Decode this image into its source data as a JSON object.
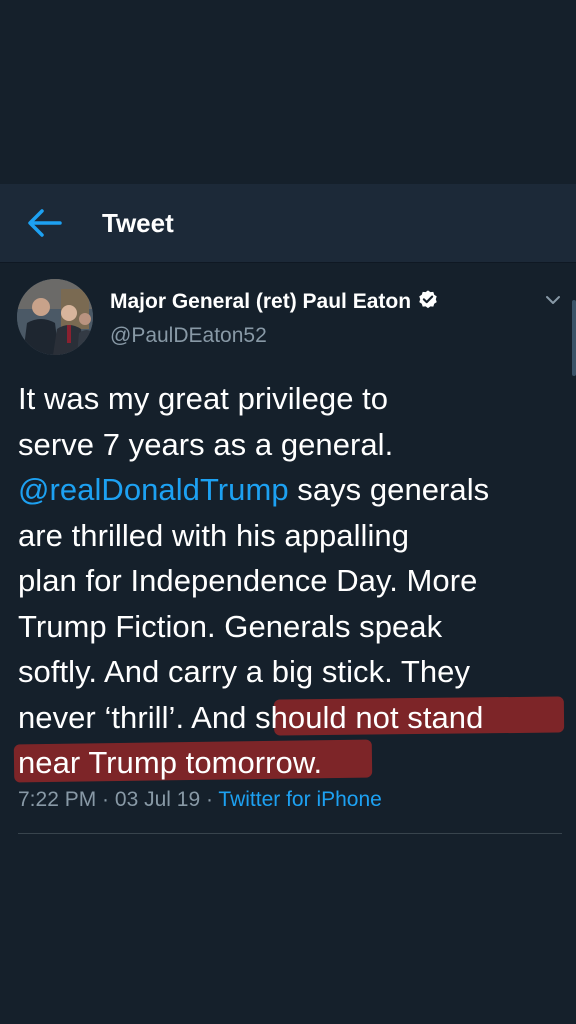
{
  "header": {
    "title": "Tweet"
  },
  "tweet": {
    "author_name": "Major General (ret) Paul Eaton",
    "author_handle": "@PaulDEaton52",
    "lines": {
      "l1": "It was my great privilege to",
      "l2": "serve 7 years as a general.",
      "mention": "@realDonaldTrump",
      "l3_rest": " says generals",
      "l4": "are thrilled with his appalling",
      "l5": "plan for Independence Day. More",
      "l6": "Trump Fiction. Generals speak",
      "l7": "softly. And carry a big stick. They",
      "l8_pre": "never ‘thrill’. And ",
      "l8_highlight": "should not stand",
      "l9_highlight": "near Trump tomorrow."
    },
    "time": "7:22 PM",
    "date": "03 Jul 19",
    "separator": " · ",
    "source": "Twitter for iPhone"
  },
  "colors": {
    "background": "#15202b",
    "header": "#1c2938",
    "accent": "#1da1f2",
    "secondary_text": "#8899a6",
    "highlight": "#aa2828"
  },
  "icons": {
    "back": "arrow-left-icon",
    "verified": "verified-badge-icon",
    "caret": "chevron-down-icon"
  }
}
